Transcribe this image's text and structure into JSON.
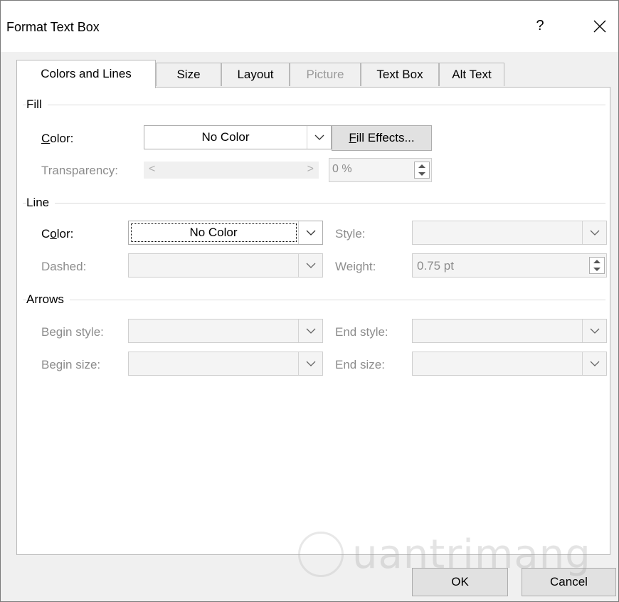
{
  "window": {
    "title": "Format Text Box",
    "help": "?"
  },
  "tabs": [
    {
      "label": "Colors and Lines",
      "active": true,
      "disabled": false
    },
    {
      "label": "Size",
      "active": false,
      "disabled": false
    },
    {
      "label": "Layout",
      "active": false,
      "disabled": false
    },
    {
      "label": "Picture",
      "active": false,
      "disabled": true
    },
    {
      "label": "Text Box",
      "active": false,
      "disabled": false
    },
    {
      "label": "Alt Text",
      "active": false,
      "disabled": false
    }
  ],
  "fill": {
    "group_label": "Fill",
    "color_label_u": "C",
    "color_label_rest": "olor:",
    "color_value": "No Color",
    "fill_effects_u": "F",
    "fill_effects_rest": "ill Effects...",
    "transparency_label": "Transparency:",
    "transparency_value": "0 %"
  },
  "line": {
    "group_label": "Line",
    "color_label_a": "C",
    "color_label_u": "o",
    "color_label_rest": "lor:",
    "color_value": "No Color",
    "style_label": "Style:",
    "dashed_label": "Dashed:",
    "weight_label": "Weight:",
    "weight_value": "0.75 pt"
  },
  "arrows": {
    "group_label": "Arrows",
    "begin_style_label": "Begin style:",
    "end_style_label": "End style:",
    "begin_size_label": "Begin size:",
    "end_size_label": "End size:"
  },
  "buttons": {
    "ok": "OK",
    "cancel": "Cancel"
  },
  "watermark": "uantrimang",
  "icons": {
    "close": "close-icon",
    "dropdown": "chevron-down-icon",
    "spin": "spin-arrows-icon",
    "slider_left": "<",
    "slider_right": ">"
  }
}
